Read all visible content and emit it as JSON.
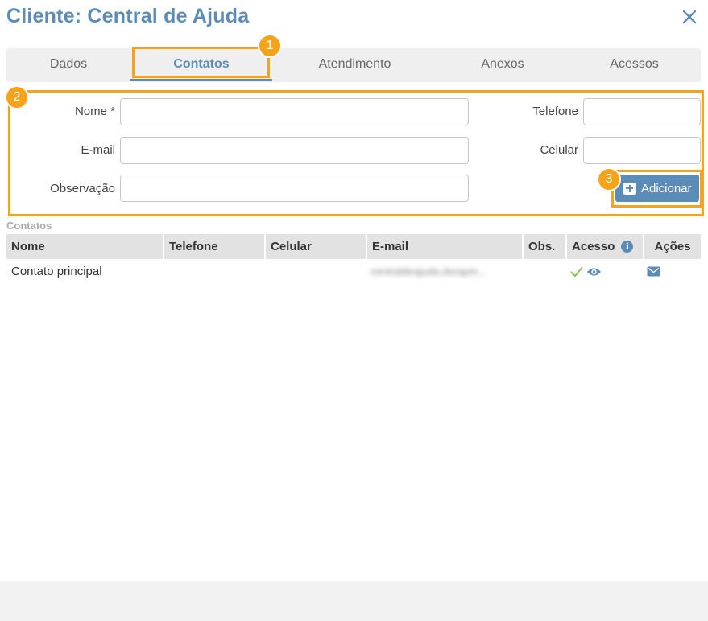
{
  "header": {
    "title": "Cliente: Central de Ajuda"
  },
  "tabs": [
    {
      "label": "Dados"
    },
    {
      "label": "Contatos"
    },
    {
      "label": "Atendimento"
    },
    {
      "label": "Anexos"
    },
    {
      "label": "Acessos"
    }
  ],
  "form": {
    "nome_label": "Nome *",
    "email_label": "E-mail",
    "observacao_label": "Observação",
    "telefone_label": "Telefone",
    "celular_label": "Celular",
    "nome_value": "",
    "email_value": "",
    "observacao_value": "",
    "telefone_value": "",
    "celular_value": "",
    "add_label": "Adicionar"
  },
  "markers": [
    "1",
    "2",
    "3"
  ],
  "contacts": {
    "section_label": "Contatos",
    "columns": [
      "Nome",
      "Telefone",
      "Celular",
      "E-mail",
      "Obs.",
      "Acesso",
      "Ações"
    ],
    "info_glyph": "i",
    "rows": [
      {
        "nome": "Contato principal",
        "telefone": "",
        "celular": "",
        "email": "centraldeajuda.dorapm...",
        "obs": ""
      }
    ]
  },
  "colors": {
    "accent": "#5b8bb7",
    "highlight": "#f5a31a",
    "check": "#8bc34a"
  },
  "icons": [
    "close-icon",
    "plus-icon",
    "info-icon",
    "check-icon",
    "eye-icon",
    "mail-icon"
  ]
}
